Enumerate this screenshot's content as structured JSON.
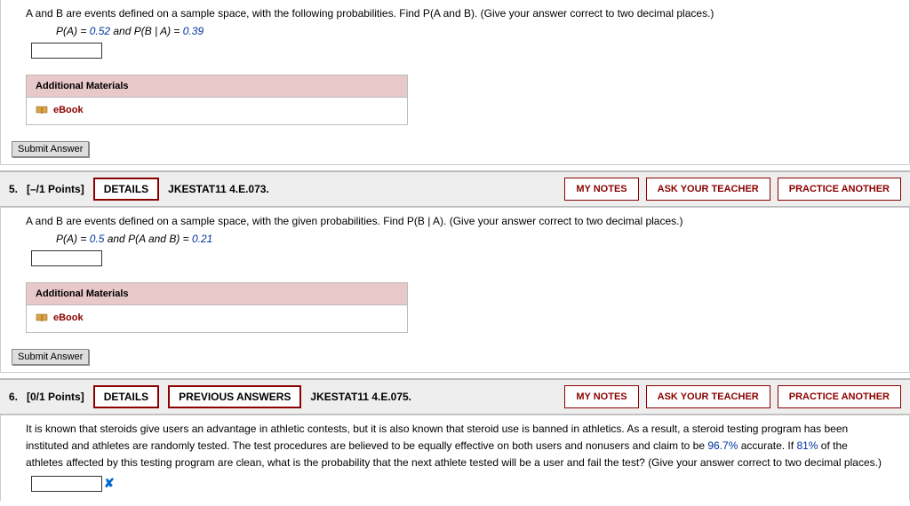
{
  "labels": {
    "additional_materials": "Additional Materials",
    "ebook": "eBook",
    "submit_answer": "Submit Answer",
    "details": "DETAILS",
    "previous_answers": "PREVIOUS ANSWERS",
    "my_notes": "MY NOTES",
    "ask_teacher": "ASK YOUR TEACHER",
    "practice_another": "PRACTICE ANOTHER"
  },
  "q4": {
    "text": "A and B are events defined on a sample space, with the following probabilities. Find P(A and B). (Give your answer correct to two decimal places.)",
    "given_prefix": "P(A) = ",
    "val_a": "0.52",
    "given_mid": " and P(B | A) = ",
    "val_b": "0.39"
  },
  "q5": {
    "number": "5.",
    "points": "[–/1 Points]",
    "ref": "JKESTAT11 4.E.073.",
    "text": "A and B are events defined on a sample space, with the given probabilities. Find P(B | A). (Give your answer correct to two decimal places.)",
    "given_prefix": "P(A) = ",
    "val_a": "0.5",
    "given_mid": " and P(A and B) = ",
    "val_b": "0.21"
  },
  "q6": {
    "number": "6.",
    "points": "[0/1 Points]",
    "ref": "JKESTAT11 4.E.075.",
    "text_a": "It is known that steroids give users an advantage in athletic contests, but it is also known that steroid use is banned in athletics. As a result, a steroid testing program has been instituted and athletes are randomly tested. The test procedures are believed to be equally effective on both users and nonusers and claim to be ",
    "val_acc": "96.7%",
    "text_b": " accurate. If ",
    "val_clean": "81%",
    "text_c": " of the athletes affected by this testing program are clean, what is the probability that the next athlete tested will be a user and fail the test? (Give your answer correct to two decimal places.)"
  }
}
